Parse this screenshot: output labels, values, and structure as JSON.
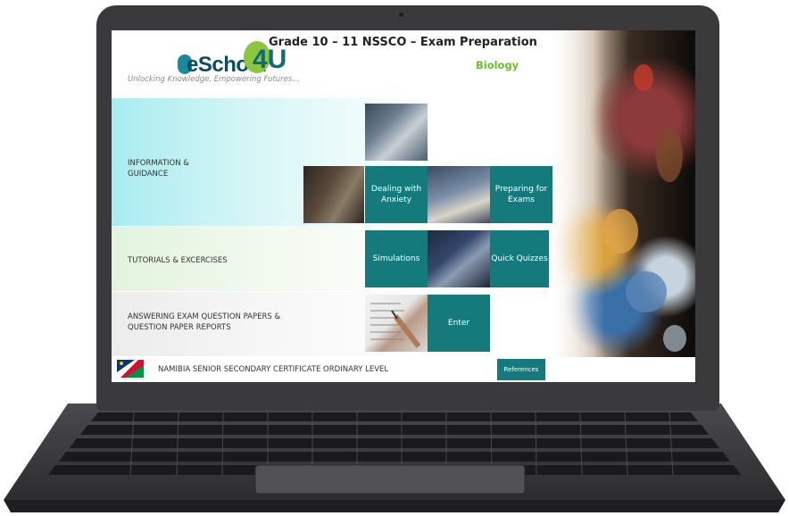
{
  "header": {
    "logo_text": "eSchool",
    "logo_suffix": "4U",
    "tagline": "Unlocking Knowledge. Empowering Futures...",
    "title": "Grade 10 – 11  NSSCO – Exam Preparation",
    "subject": "Biology"
  },
  "sections": {
    "info_label_line1": "INFORMATION &",
    "info_label_line2": "GUIDANCE",
    "tutorials_label": "TUTORIALS & EXCERCISES",
    "answering_label_line1": "ANSWERING EXAM QUESTION PAPERS &",
    "answering_label_line2": "QUESTION PAPER REPORTS"
  },
  "tiles": {
    "anxiety_line1": "Dealing with",
    "anxiety_line2": "Anxiety",
    "preparing_line1": "Preparing for",
    "preparing_line2": "Exams",
    "simulations": "Simulations",
    "quizzes": "Quick Quizzes",
    "enter": "Enter"
  },
  "footer": {
    "text": "NAMIBIA SENIOR SECONDARY CERTIFICATE ORDINARY LEVEL",
    "references": "References"
  },
  "colors": {
    "tile": "#157a7c",
    "subject": "#6abf2a",
    "logo": "#0b4d5e",
    "logo_accent": "#8dc63f",
    "laptop": "#3a3a3d"
  },
  "icons": [
    "namibia-flag-icon",
    "laptop-camera-icon"
  ]
}
